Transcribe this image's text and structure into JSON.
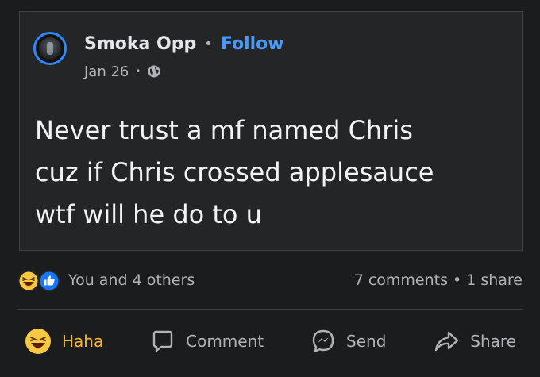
{
  "post": {
    "author": "Smoka Opp",
    "separator": "•",
    "follow_label": "Follow",
    "date": "Jan 26",
    "meta_separator": "•",
    "privacy_icon": "globe-icon",
    "text": "Never trust a mf named Chris\ncuz if Chris crossed applesauce\nwtf will he do to u"
  },
  "reactions": {
    "icons": [
      "haha-reaction-icon",
      "like-reaction-icon"
    ],
    "summary": "You and 4 others",
    "comments": "7 comments",
    "dot": "•",
    "shares": "1 share"
  },
  "actions": {
    "haha_label": "Haha",
    "comment_label": "Comment",
    "send_label": "Send",
    "share_label": "Share"
  },
  "colors": {
    "background": "#1b1c1e",
    "card": "#242526",
    "accent_blue": "#4599ff",
    "haha_yellow": "#f7b928",
    "muted_text": "#b0b3b8"
  }
}
